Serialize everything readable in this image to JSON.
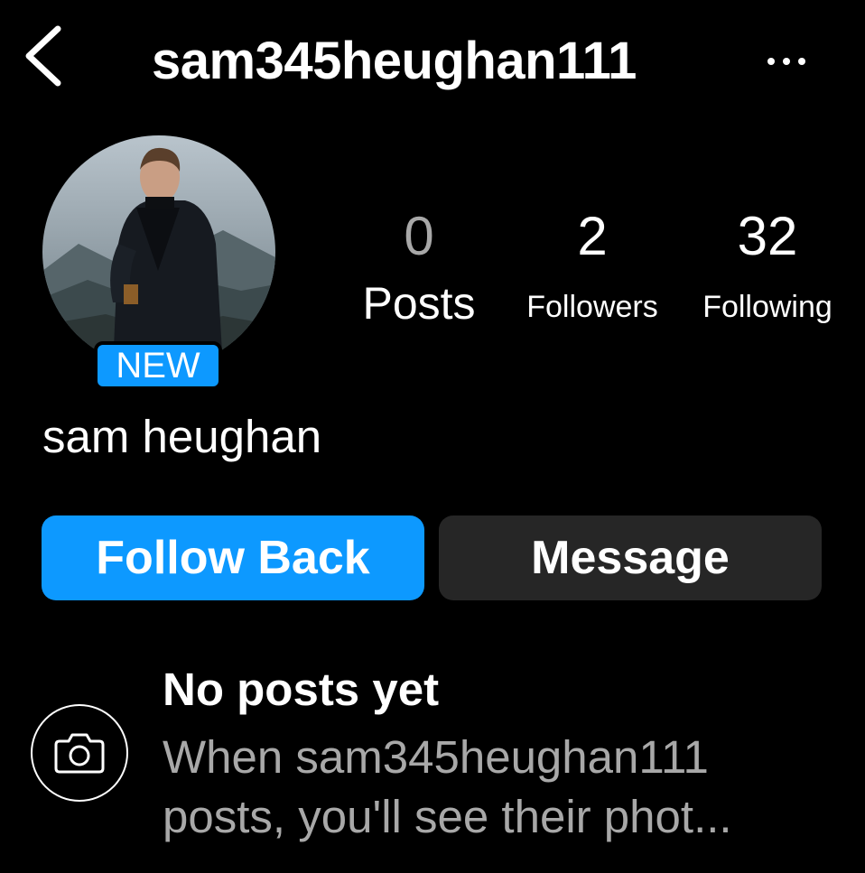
{
  "header": {
    "username": "sam345heughan111",
    "back_icon": "chevron-left-icon",
    "more_icon": "ellipsis-icon"
  },
  "profile": {
    "avatar": "profile-photo",
    "badge": "NEW",
    "full_name": "sam heughan"
  },
  "stats": {
    "posts": {
      "count": "0",
      "label": "Posts"
    },
    "followers": {
      "count": "2",
      "label": "Followers"
    },
    "following": {
      "count": "32",
      "label": "Following"
    }
  },
  "actions": {
    "follow_back_label": "Follow Back",
    "message_label": "Message"
  },
  "empty_state": {
    "icon": "camera-icon",
    "title": "No posts yet",
    "description_line1": "When sam345heughan111",
    "description_line2": "posts, you'll see their phot..."
  },
  "colors": {
    "background": "#000000",
    "accent": "#0d99ff",
    "secondary_button": "#262626",
    "muted_text": "#a8a8a8"
  }
}
